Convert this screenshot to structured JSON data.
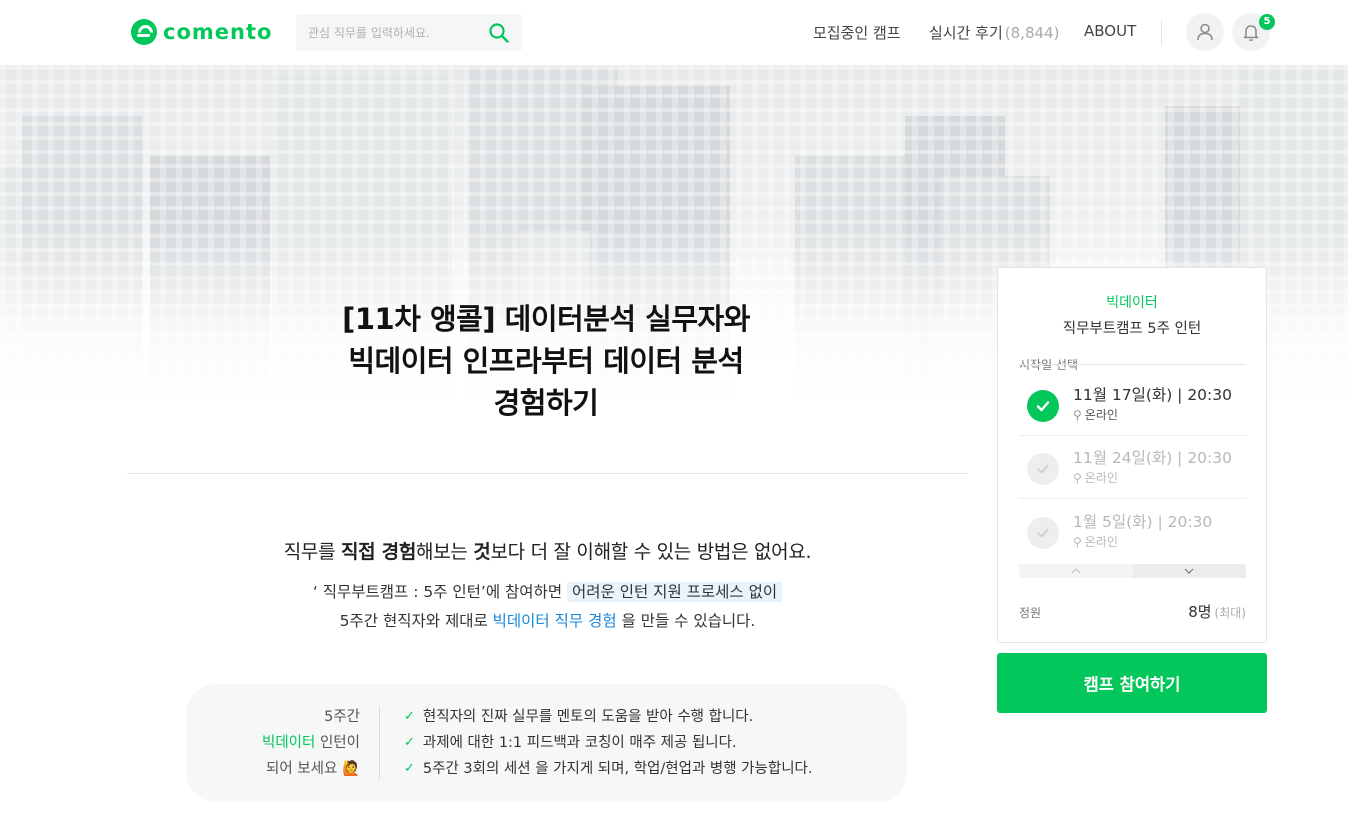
{
  "header": {
    "logo_text": "comento",
    "search_placeholder": "관심 직무를 입력하세요.",
    "nav": {
      "recruiting_camp": "모집중인 캠프",
      "reviews_label": "실시간 후기",
      "reviews_count": "(8,844)",
      "about": "ABOUT"
    },
    "notification_count": "5"
  },
  "hero": {
    "title_line1": "[11차 앵콜] 데이터분석 실무자와",
    "title_line2": "빅데이터 인프라부터 데이터 분석",
    "title_line3": "경험하기"
  },
  "intro": {
    "lead_part1": "직무를 ",
    "lead_bold1": "직접 경험",
    "lead_part2": "해보는 ",
    "lead_bold2": "것",
    "lead_part3": "보다 더 잘 이해할 수 있는 방법은 없어요.",
    "desc_line1_a": "‘ 직무부트캠프 : 5주 인턴’에 참여하면 ",
    "desc_line1_highlight": "어려운 인턴 지원 프로세스 없이",
    "desc_line2_a": "5주간 현직자와 제대로 ",
    "desc_line2_link": "빅데이터 직무 경험",
    "desc_line2_b": " 을 만들 수 있습니다."
  },
  "benefit": {
    "left_line1": "5주간",
    "left_line2_green": "빅데이터",
    "left_line2_rest": " 인턴이",
    "left_line3": "되어 보세요",
    "left_emoji": "🙋",
    "items": [
      "현직자의 진짜 실무를 멘토의 도움을 받아 수행 합니다.",
      "과제에 대한 1:1 피드백과 코칭이 매주 제공 됩니다.",
      "5주간 3회의 세션 을 가지게 되며, 학업/현업과 병행 가능합니다."
    ]
  },
  "sidebar": {
    "category": "빅데이터",
    "camp_name": "직무부트캠프 5주 인턴",
    "start_label": "시작일 선택",
    "dates": [
      {
        "date": "11월 17일(화) | 20:30",
        "location": "온라인",
        "selected": true
      },
      {
        "date": "11월 24일(화) | 20:30",
        "location": "온라인",
        "selected": false
      },
      {
        "date": "1월 5일(화) | 20:30",
        "location": "온라인",
        "selected": false
      }
    ],
    "capacity_label": "정원",
    "capacity_value": "8명",
    "capacity_note": "(최대)",
    "join_button": "캠프 참여하기"
  },
  "colors": {
    "brand_green": "#03c75a",
    "link_blue": "#1a87d8",
    "highlight_bg": "#e8f3fb"
  }
}
